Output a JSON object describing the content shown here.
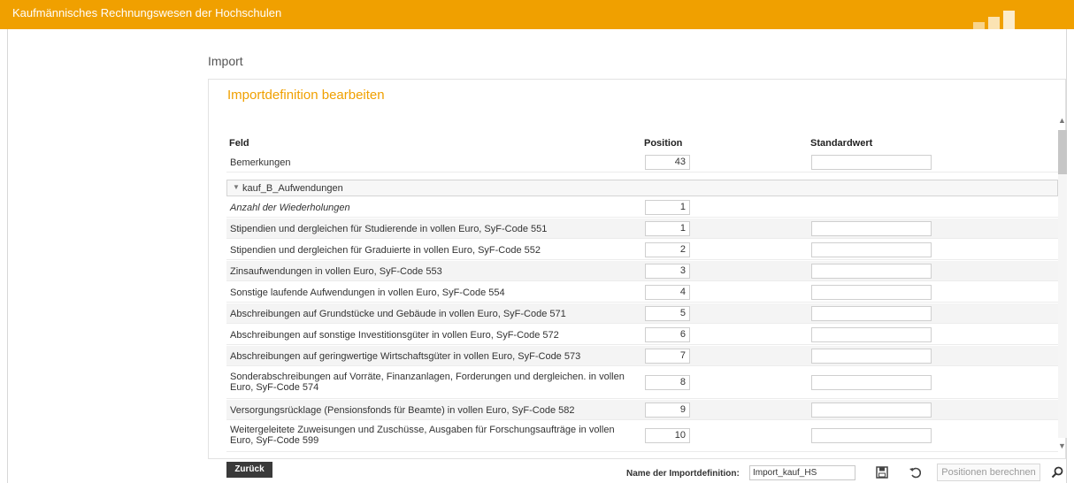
{
  "app": {
    "title": "Kaufmännisches Rechnungswesen der Hochschulen"
  },
  "breadcrumb": "Import",
  "panel": {
    "title": "Importdefinition bearbeiten"
  },
  "columns": {
    "field": "Feld",
    "position": "Position",
    "default": "Standardwert"
  },
  "top_row": {
    "label": "Bemerkungen",
    "position": "43",
    "default": ""
  },
  "group": {
    "label": "kauf_B_Aufwendungen",
    "expanded": true
  },
  "repeat_row": {
    "label": "Anzahl der Wiederholungen",
    "position": "1"
  },
  "rows": [
    {
      "label": "Stipendien und dergleichen für Studierende in vollen Euro, SyF-Code 551",
      "position": "1",
      "default": ""
    },
    {
      "label": "Stipendien und dergleichen für Graduierte in vollen Euro, SyF-Code 552",
      "position": "2",
      "default": ""
    },
    {
      "label": "Zinsaufwendungen in vollen Euro, SyF-Code 553",
      "position": "3",
      "default": ""
    },
    {
      "label": "Sonstige laufende Aufwendungen in vollen Euro, SyF-Code 554",
      "position": "4",
      "default": ""
    },
    {
      "label": "Abschreibungen auf Grundstücke und Gebäude in vollen Euro, SyF-Code 571",
      "position": "5",
      "default": ""
    },
    {
      "label": "Abschreibungen auf sonstige Investitionsgüter in vollen Euro, SyF-Code 572",
      "position": "6",
      "default": ""
    },
    {
      "label": "Abschreibungen auf geringwertige Wirtschaftsgüter in vollen Euro, SyF-Code 573",
      "position": "7",
      "default": ""
    },
    {
      "label": "Sonderabschreibungen auf Vorräte, Finanzanlagen, Forderungen und dergleichen. in vollen Euro, SyF-Code 574",
      "position": "8",
      "default": ""
    },
    {
      "label": "Versorgungsrücklage (Pensionsfonds für Beamte) in vollen Euro, SyF-Code 582",
      "position": "9",
      "default": ""
    },
    {
      "label": "Weitergeleitete Zuweisungen und Zuschüsse, Ausgaben für Forschungsaufträge in vollen Euro, SyF-Code 599",
      "position": "10",
      "default": ""
    }
  ],
  "footer": {
    "back_label": "Zurück",
    "name_label": "Name der Importdefinition:",
    "name_value": "Import_kauf_HS",
    "calc_label": "Positionen berechnen",
    "save_icon": "save-icon",
    "undo_icon": "undo-icon",
    "search_icon": "search-icon"
  },
  "colors": {
    "accent": "#f0a000",
    "button_dark": "#3a3a3a"
  }
}
